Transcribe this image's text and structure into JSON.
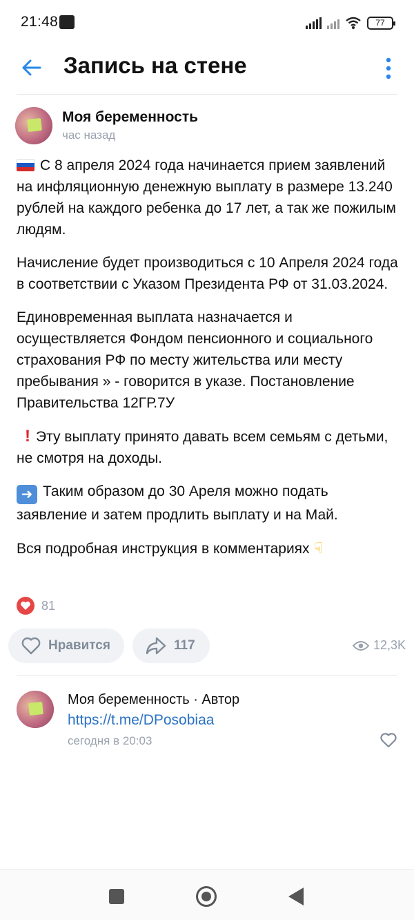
{
  "status_bar": {
    "time": "21:48",
    "battery": "77"
  },
  "header": {
    "title": "Запись на стене",
    "back_icon": "arrow-left-icon",
    "more_icon": "more-vertical-icon",
    "accent_color": "#2688eb"
  },
  "post": {
    "author": "Моя беременность",
    "time": "час назад",
    "paragraphs": [
      "С 8 апреля 2024 года начинается прием заявлений на инфляционную денежную выплату в размере 13.240 рублей на каждого ребенка до 17 лет, а так же пожилым людям.",
      " Начисление будет производиться с 10 Апреля 2024 года в соответствии с Указом Президента РФ от 31.03.2024.",
      " Единовременная выплата назначается и осуществляется Фондом пенсионного и социального страхования РФ по месту жительства или месту пребывания » - говорится в указе. Постановление Правительства 12ГР.7У",
      "Эту выплату принято давать всем семьям с детьми, не смотря на доходы.",
      "Таким образом до 30 Ареля можно подать заявление и затем продлить выплату и на Май.",
      " Вся подробная инструкция в комментариях"
    ],
    "reaction_count": "81",
    "like_label": "Нравится",
    "share_count": "117",
    "views": "12,3K"
  },
  "comment": {
    "author": "Моя беременность · Автор",
    "text": "https://t.me/DPosobiaa",
    "time": "сегодня в 20:03"
  }
}
